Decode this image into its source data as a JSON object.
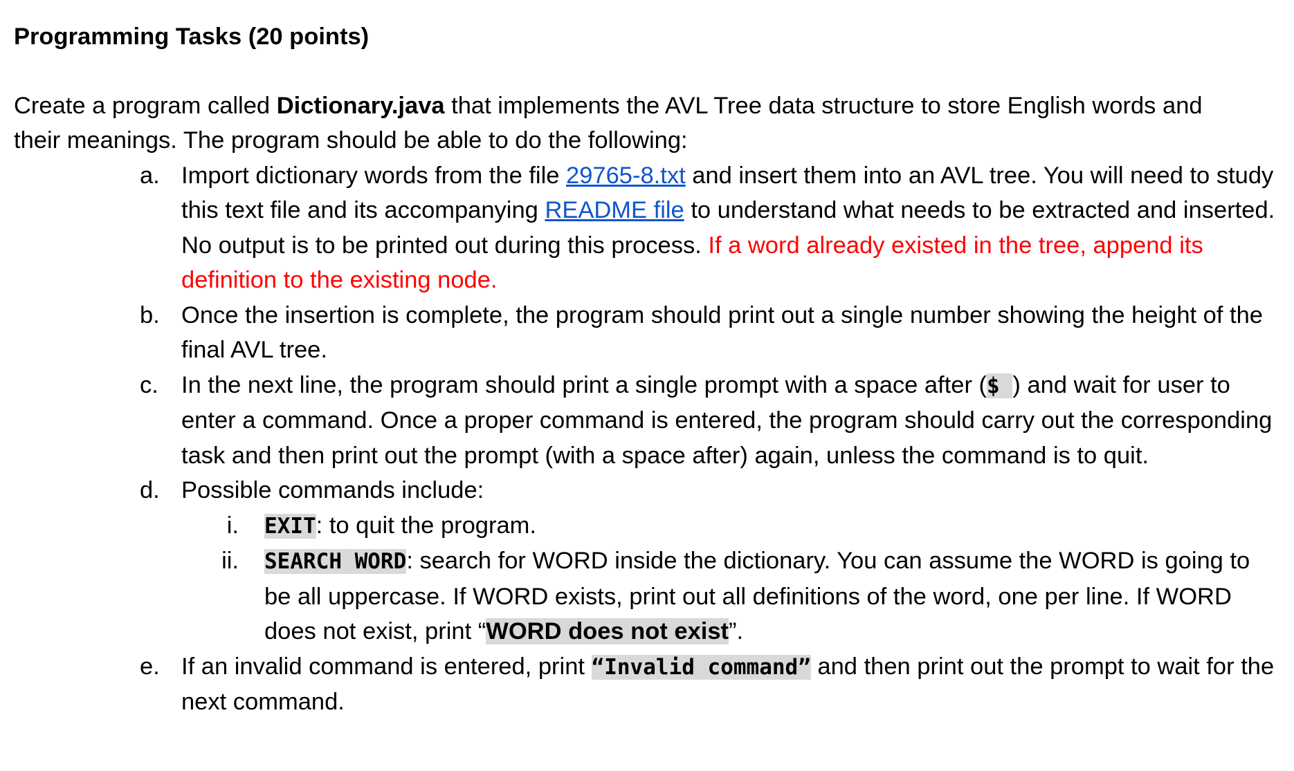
{
  "heading": "Programming Tasks (20 points)",
  "intro": {
    "t1": "Create a program called ",
    "filename": "Dictionary.java",
    "t2": " that implements the AVL Tree data structure to store English words and their meanings. The program should be able to do the following:"
  },
  "items": {
    "a": {
      "marker": "a.",
      "t1": "Import dictionary words from the file ",
      "link1": "29765-8.txt",
      "t2": " and insert them into an AVL tree. You will need to study this text file and its accompanying ",
      "link2": "README file",
      "t3": " to understand what needs to be extracted and inserted. No output is to be printed out during this process. ",
      "red": "If a word already existed in the tree, append its definition to the existing node."
    },
    "b": {
      "marker": "b.",
      "text": "Once the insertion is complete, the program should print out a single number showing the height of the final AVL tree."
    },
    "c": {
      "marker": "c.",
      "t1": "In the next line, the program should print a single prompt with a space after (",
      "prompt": "$ ",
      "t2": ") and wait for user to enter a command. Once a proper command is entered, the program should carry out the corresponding task and then print out the prompt (with a space after) again, unless the command is to quit."
    },
    "d": {
      "marker": "d.",
      "text": "Possible commands include:",
      "sub": {
        "i": {
          "marker": "i.",
          "code": "EXIT",
          "text": ": to quit the program."
        },
        "ii": {
          "marker": "ii.",
          "code": "SEARCH WORD",
          "t1": ": search for WORD inside the dictionary. You can assume the WORD is going to be all uppercase. If WORD exists, print out all definitions of the word, one per line. If WORD does not exist, print “",
          "hl": "WORD does not exist",
          "t2": "”."
        }
      }
    },
    "e": {
      "marker": "e.",
      "t1": "If an invalid command is entered, print ",
      "code": "“Invalid command”",
      "t2": " and then print out the prompt to wait for the next command."
    }
  }
}
